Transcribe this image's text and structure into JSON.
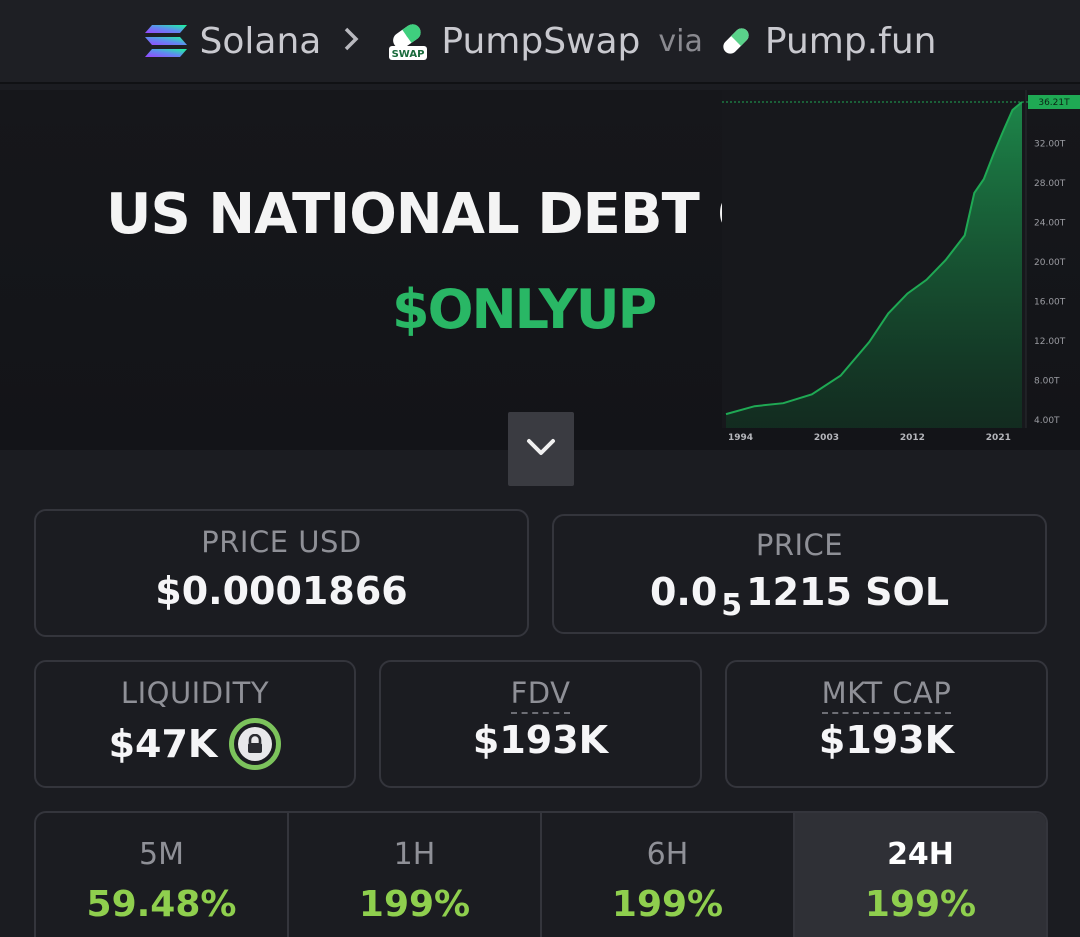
{
  "breadcrumb": {
    "chain": "Solana",
    "dex": "PumpSwap",
    "dex_badge": "SWAP",
    "via": "via",
    "launchpad": "Pump.fun"
  },
  "banner": {
    "title": "US NATIONAL DEBT CHART",
    "ticker": "$ONLYUP",
    "chart_data": {
      "type": "area",
      "x_ticks": [
        "1994",
        "2003",
        "2012",
        "2021"
      ],
      "y_ticks": [
        "32.00T",
        "28.00T",
        "24.00T",
        "20.00T",
        "16.00T",
        "12.00T",
        "8.00T",
        "4.00T"
      ],
      "last_value_label": "36.21T",
      "x": [
        1994,
        1997,
        2000,
        2003,
        2006,
        2009,
        2011,
        2013,
        2015,
        2017,
        2019,
        2020,
        2021,
        2022,
        2023,
        2024,
        2025
      ],
      "values": [
        4.6,
        5.4,
        5.7,
        6.6,
        8.5,
        11.9,
        14.8,
        16.8,
        18.2,
        20.2,
        22.7,
        27.0,
        28.4,
        30.9,
        33.2,
        35.4,
        36.21
      ],
      "ylim": [
        4,
        36.21
      ],
      "xlim": [
        1994,
        2025
      ],
      "color": "#1fa954",
      "grid": false
    }
  },
  "stats": {
    "price_usd": {
      "label": "PRICE USD",
      "value": "$0.0001866"
    },
    "price": {
      "label": "PRICE",
      "prefix": "0.0",
      "zeros": "5",
      "digits": "1215",
      "unit": "SOL"
    },
    "liquidity": {
      "label": "LIQUIDITY",
      "value": "$47K"
    },
    "fdv": {
      "label": "FDV",
      "value": "$193K"
    },
    "mkt_cap": {
      "label": "MKT CAP",
      "value": "$193K"
    }
  },
  "timeframes": [
    {
      "label": "5M",
      "change": "59.48%"
    },
    {
      "label": "1H",
      "change": "199%"
    },
    {
      "label": "6H",
      "change": "199%"
    },
    {
      "label": "24H",
      "change": "199%",
      "active": true
    }
  ],
  "colors": {
    "positive": "#8fcf4e",
    "accent": "#29b765",
    "lock_ring": "#7cc35c"
  }
}
